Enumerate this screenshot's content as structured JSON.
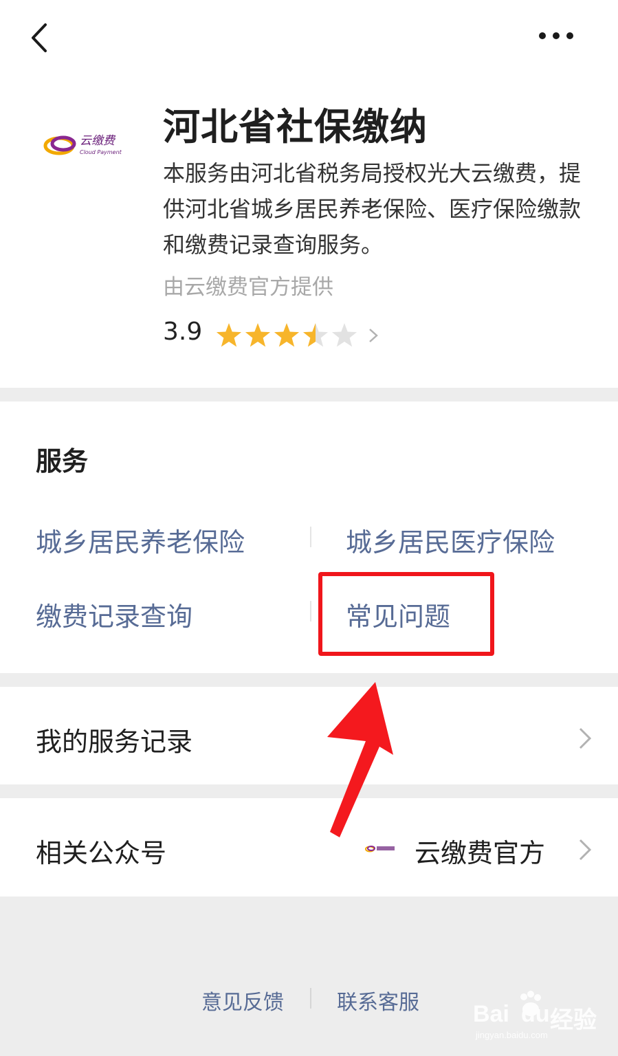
{
  "header": {
    "title": "河北省社保缴纳",
    "description": "本服务由河北省税务局授权光大云缴费，提供河北省城乡居民养老保险、医疗保险缴款和缴费记录查询服务。",
    "provider": "由云缴费官方提供",
    "rating": "3.9",
    "rating_stars": 3.5,
    "rating_max": 5,
    "logo_text": "云缴费",
    "logo_subtext": "Cloud Payment"
  },
  "services": {
    "title": "服务",
    "items": [
      {
        "label": "城乡居民养老保险"
      },
      {
        "label": "城乡居民医疗保险"
      },
      {
        "label": "缴费记录查询"
      },
      {
        "label": "常见问题"
      }
    ]
  },
  "service_record": {
    "label": "我的服务记录"
  },
  "related_account": {
    "label": "相关公众号",
    "value": "云缴费官方"
  },
  "footer": {
    "feedback": "意见反馈",
    "contact": "联系客服"
  },
  "watermark": {
    "text": "Bai",
    "text2": "du",
    "text3": "经验",
    "sub": "jingyan.baidu.com"
  },
  "colors": {
    "link": "#576b95",
    "star": "#f7b52b",
    "highlight": "#f0161b",
    "logo_purple": "#6a1f7a"
  }
}
